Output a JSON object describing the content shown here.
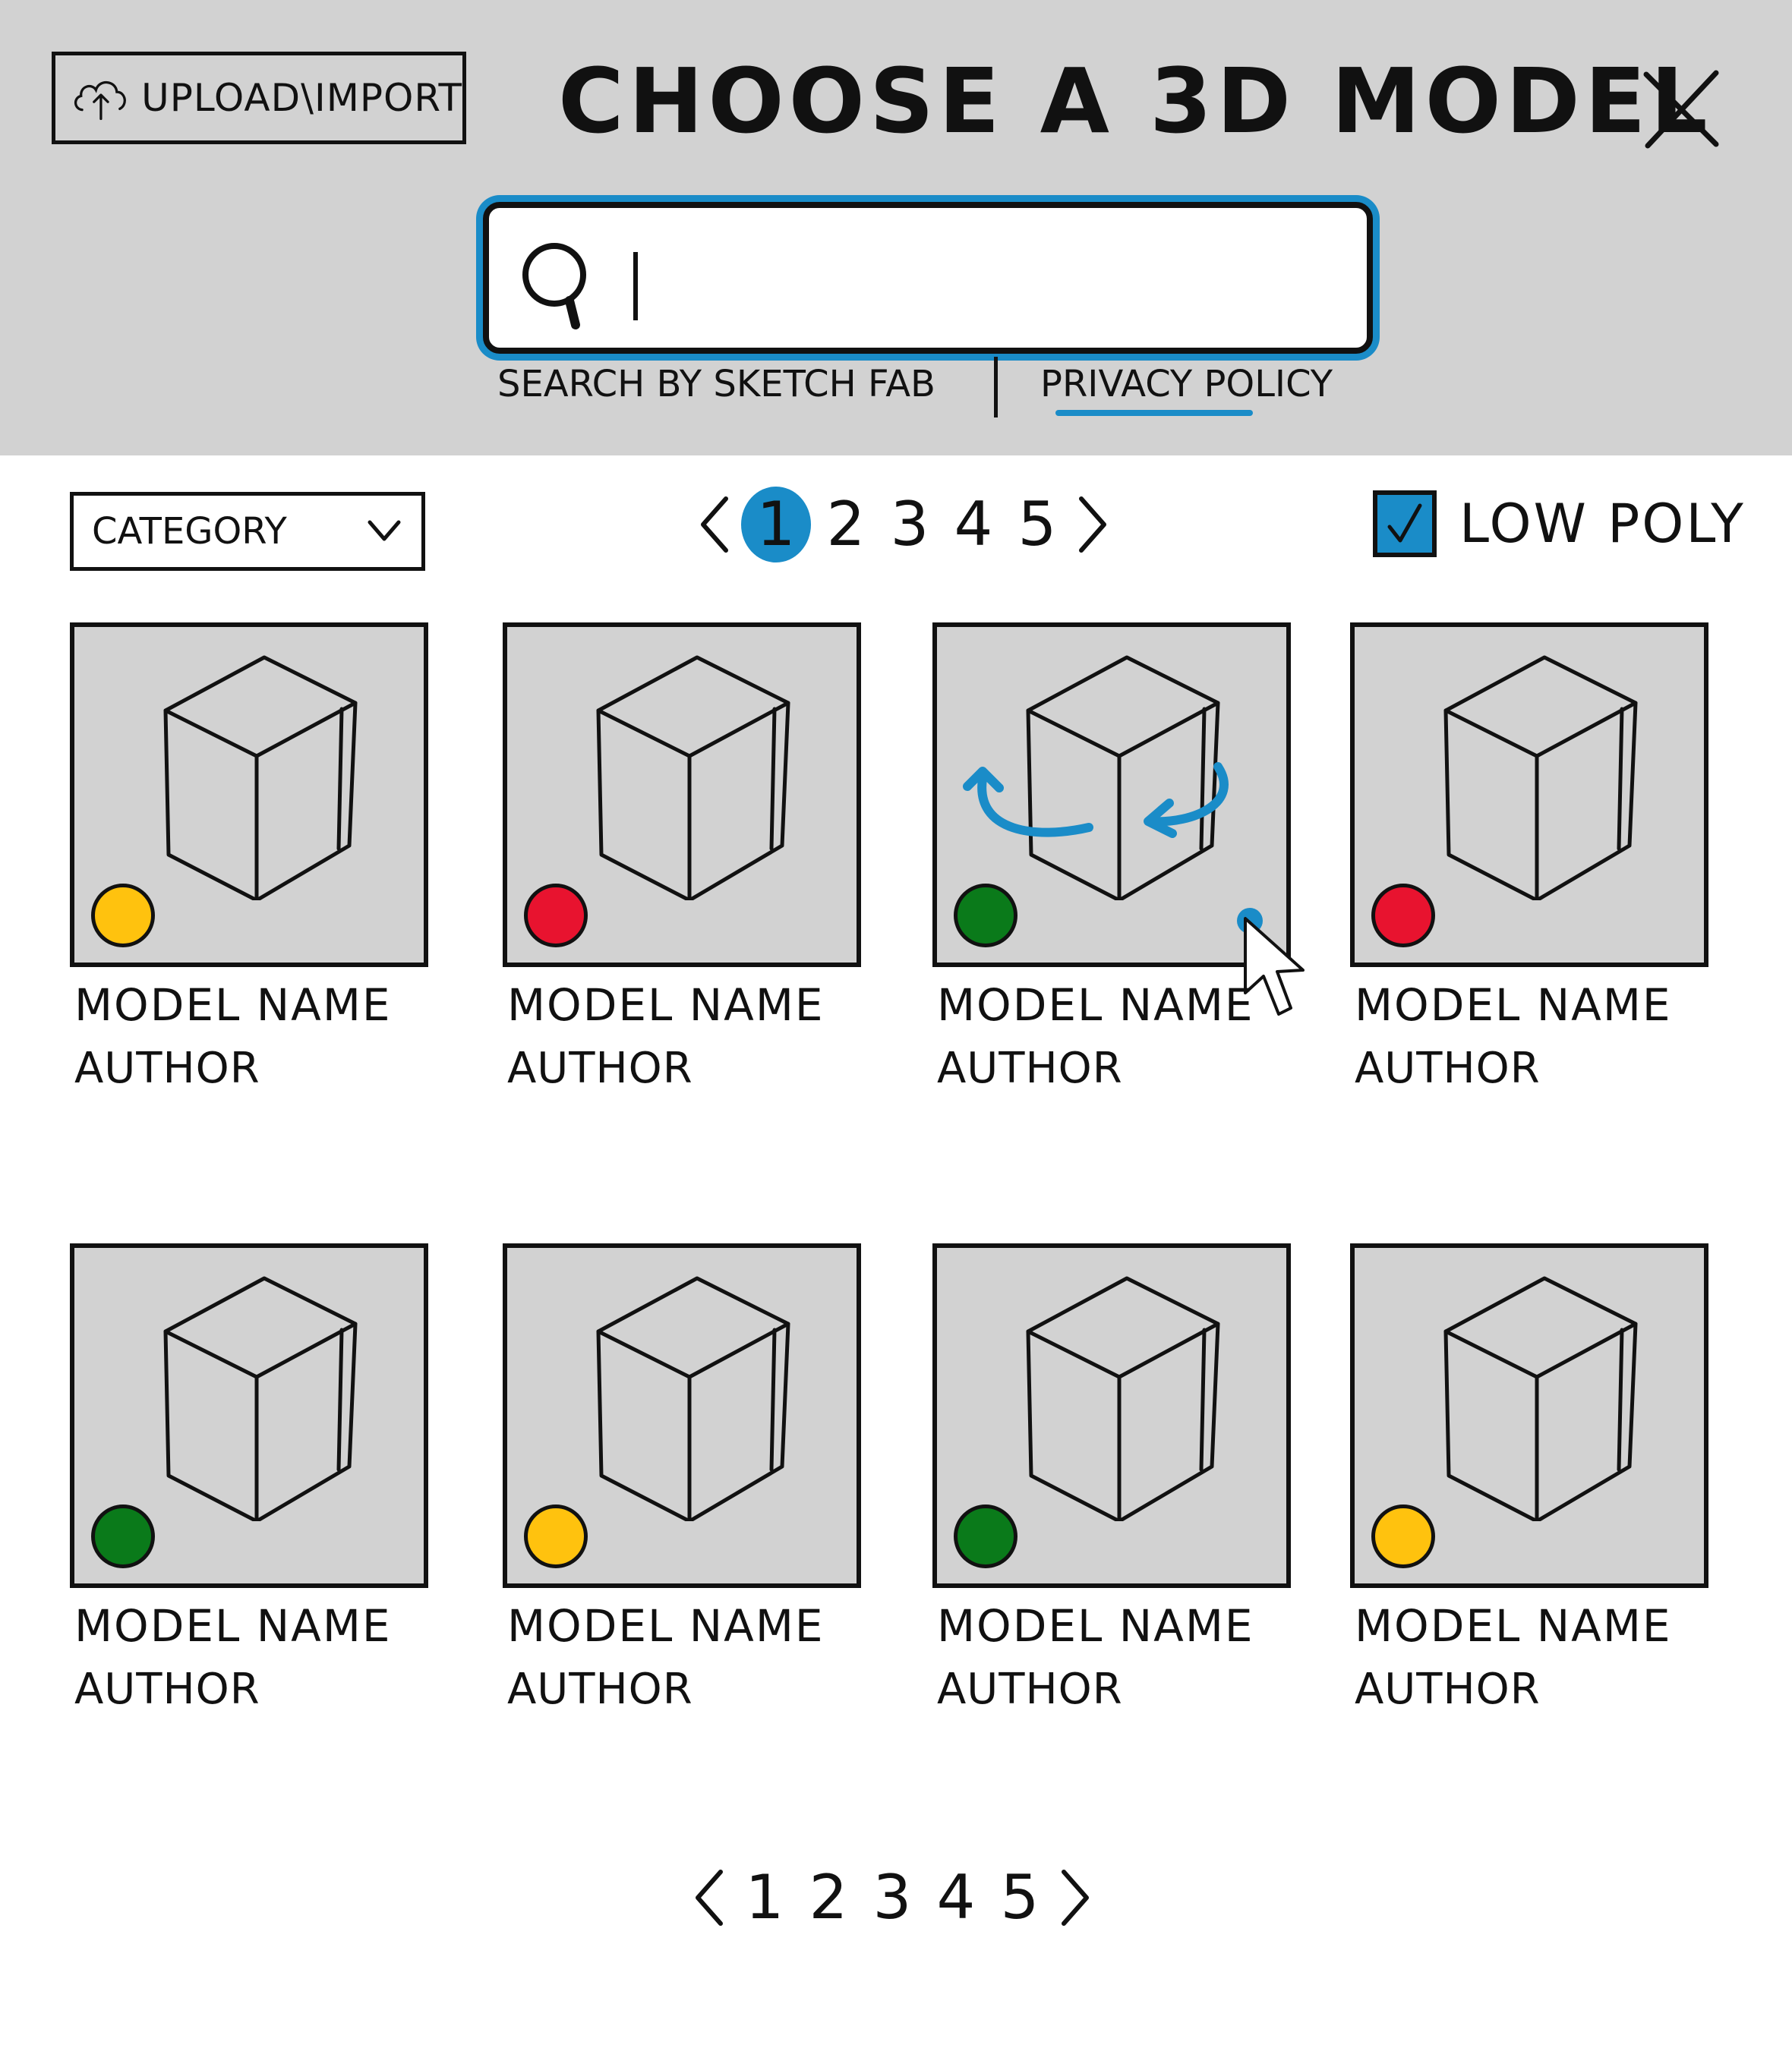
{
  "header": {
    "upload_label": "UPLOAD\\IMPORT",
    "title": "CHOOSE A 3D MODEL",
    "search_by": "SEARCH BY SKETCH FAB",
    "privacy_policy": "PRIVACY POLICY"
  },
  "search": {
    "value": "",
    "placeholder": ""
  },
  "filters": {
    "category_label": "CATEGORY",
    "low_poly_label": "LOW POLY",
    "low_poly_checked": true
  },
  "pagination": {
    "prev": "<",
    "next": ">",
    "pages": [
      "1",
      "2",
      "3",
      "4",
      "5"
    ],
    "current": "1"
  },
  "colors": {
    "accent": "#1a8cc8",
    "header_bg": "#d2d2d2",
    "yellow": "#ffc20e",
    "red": "#e8132f",
    "green": "#0a7a1a"
  },
  "models": [
    {
      "name": "MODEL NAME",
      "author": "AUTHOR",
      "status": "yellow"
    },
    {
      "name": "MODEL NAME",
      "author": "AUTHOR",
      "status": "red"
    },
    {
      "name": "MODEL NAME",
      "author": "AUTHOR",
      "status": "green",
      "hovered": true
    },
    {
      "name": "MODEL NAME",
      "author": "AUTHOR",
      "status": "red"
    },
    {
      "name": "MODEL NAME",
      "author": "AUTHOR",
      "status": "green"
    },
    {
      "name": "MODEL NAME",
      "author": "AUTHOR",
      "status": "yellow"
    },
    {
      "name": "MODEL NAME",
      "author": "AUTHOR",
      "status": "green"
    },
    {
      "name": "MODEL NAME",
      "author": "AUTHOR",
      "status": "yellow"
    }
  ]
}
